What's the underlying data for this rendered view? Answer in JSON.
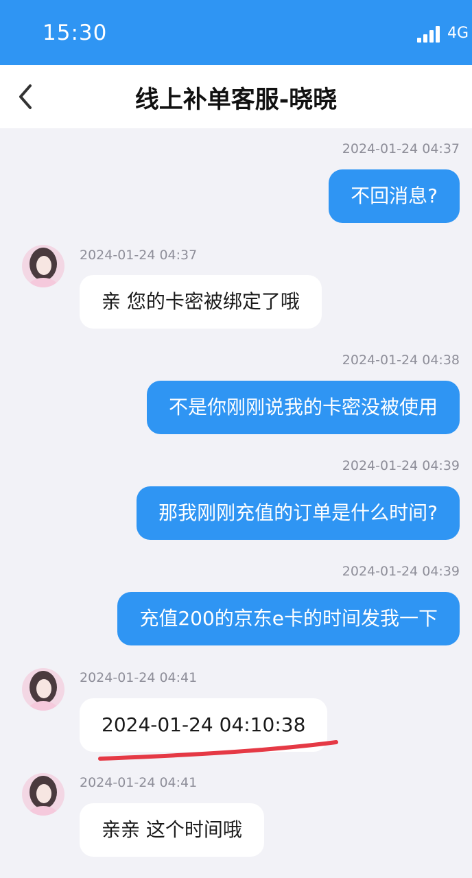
{
  "status_bar": {
    "time": "15:30",
    "network": "4G",
    "signal_icon": "signal-bars-icon"
  },
  "header": {
    "back_icon": "chevron-left-icon",
    "title": "线上补单客服-晓晓"
  },
  "messages": [
    {
      "side": "out",
      "time": "2024-01-24 04:37",
      "text": "不回消息?"
    },
    {
      "side": "in",
      "time": "2024-01-24 04:37",
      "text": "亲 您的卡密被绑定了哦"
    },
    {
      "side": "out",
      "time": "2024-01-24 04:38",
      "text": "不是你刚刚说我的卡密没被使用"
    },
    {
      "side": "out",
      "time": "2024-01-24 04:39",
      "text": "那我刚刚充值的订单是什么时间?"
    },
    {
      "side": "out",
      "time": "2024-01-24 04:39",
      "text": "充值200的京东e卡的时间发我一下"
    },
    {
      "side": "in",
      "time": "2024-01-24 04:41",
      "text": "2024-01-24 04:10:38"
    },
    {
      "side": "in",
      "time": "2024-01-24 04:41",
      "text": "亲亲 这个时间哦"
    }
  ],
  "colors": {
    "accent": "#2f95f3",
    "annotation": "#e53945",
    "background": "#f2f2f7"
  }
}
